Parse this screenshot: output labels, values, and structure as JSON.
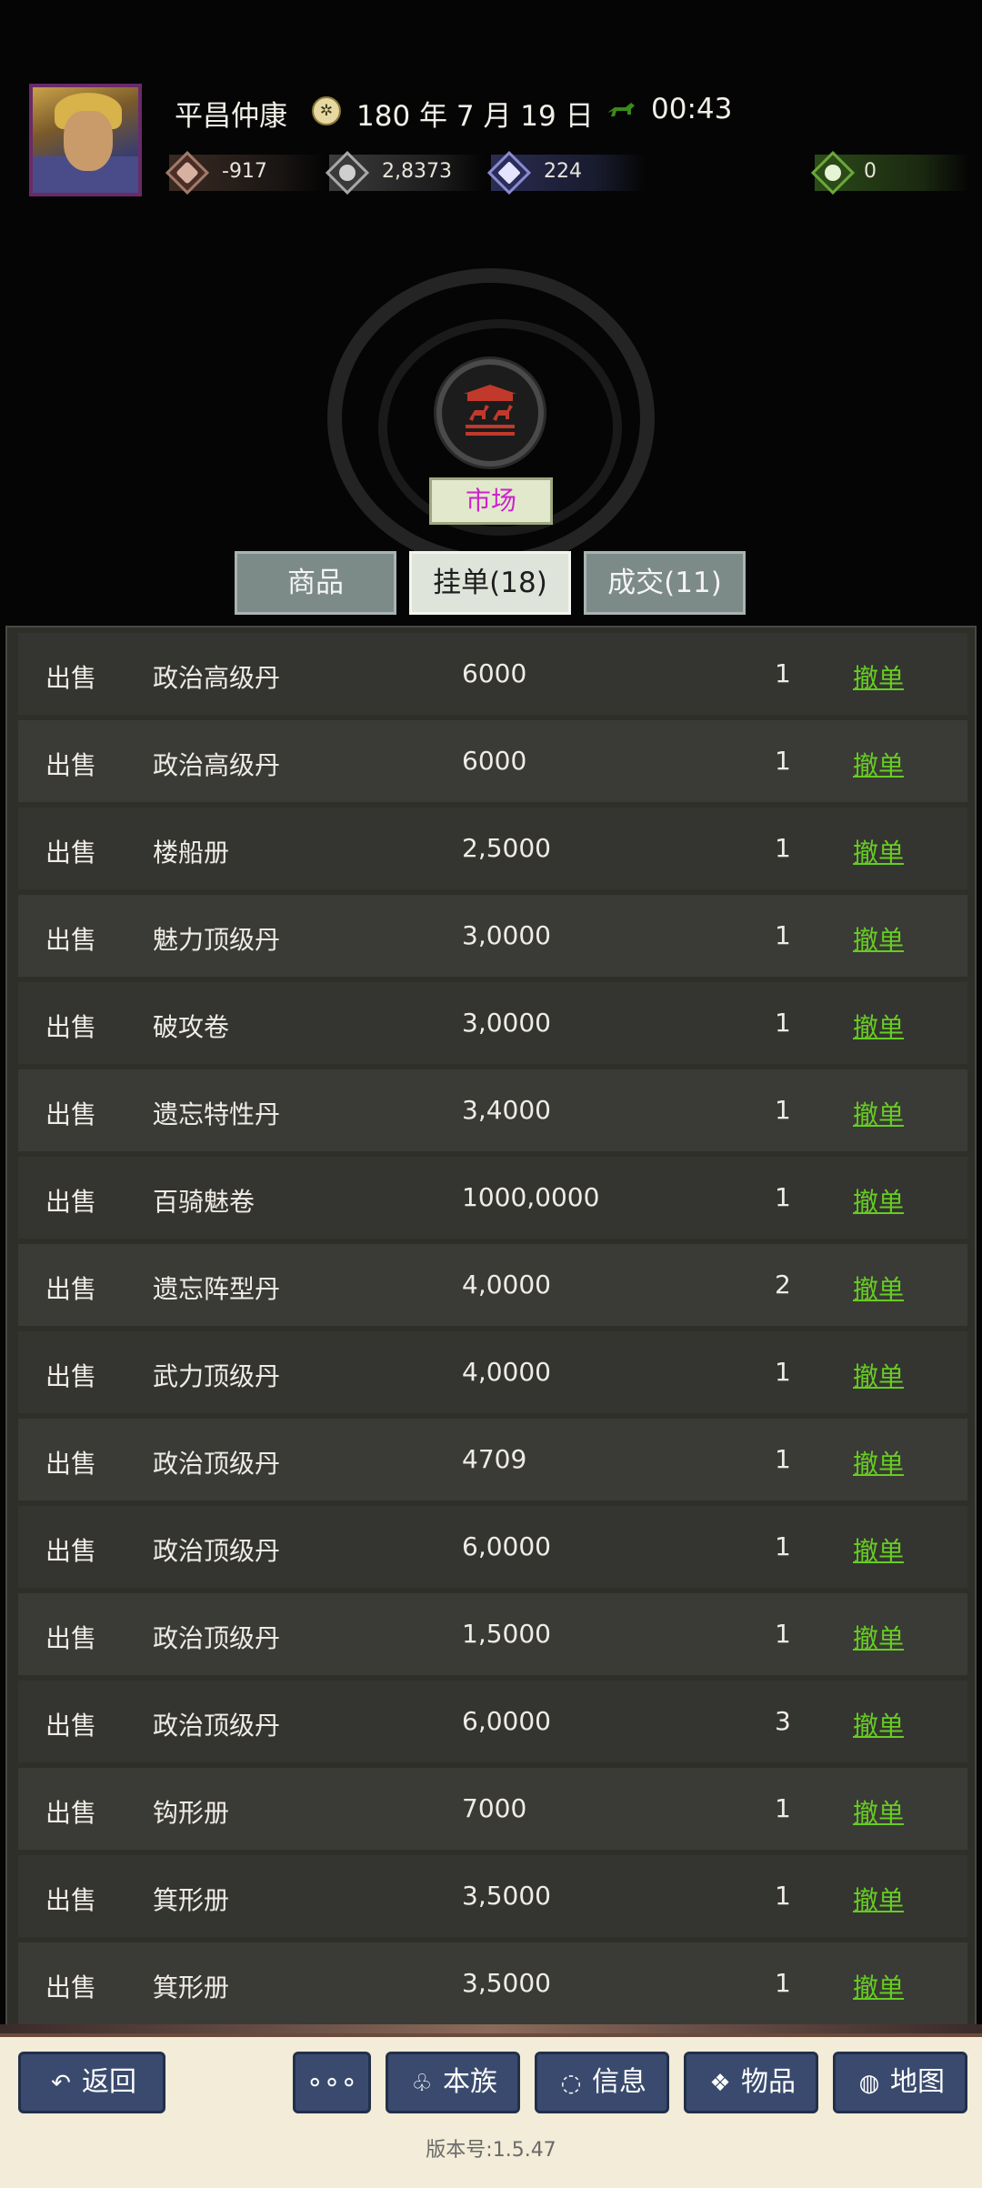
{
  "header": {
    "player_name": "平昌仲康",
    "date": "180 年 7 月 19 日",
    "time": "00:43"
  },
  "stats": [
    {
      "name": "money",
      "value": "-917"
    },
    {
      "name": "food",
      "value": "2,8373"
    },
    {
      "name": "troops",
      "value": "224"
    },
    {
      "name": "item",
      "value": "0"
    }
  ],
  "market": {
    "title": "市场"
  },
  "tabs": [
    {
      "label": "商品"
    },
    {
      "label": "挂单(18)"
    },
    {
      "label": "成交(11)"
    }
  ],
  "orders": [
    {
      "type": "出售",
      "name": "政治高级丹",
      "price": "6000",
      "qty": "1",
      "action": "撤单"
    },
    {
      "type": "出售",
      "name": "政治高级丹",
      "price": "6000",
      "qty": "1",
      "action": "撤单"
    },
    {
      "type": "出售",
      "name": "楼船册",
      "price": "2,5000",
      "qty": "1",
      "action": "撤单"
    },
    {
      "type": "出售",
      "name": "魅力顶级丹",
      "price": "3,0000",
      "qty": "1",
      "action": "撤单"
    },
    {
      "type": "出售",
      "name": "破攻卷",
      "price": "3,0000",
      "qty": "1",
      "action": "撤单"
    },
    {
      "type": "出售",
      "name": "遗忘特性丹",
      "price": "3,4000",
      "qty": "1",
      "action": "撤单"
    },
    {
      "type": "出售",
      "name": "百骑魅卷",
      "price": "1000,0000",
      "qty": "1",
      "action": "撤单"
    },
    {
      "type": "出售",
      "name": "遗忘阵型丹",
      "price": "4,0000",
      "qty": "2",
      "action": "撤单"
    },
    {
      "type": "出售",
      "name": "武力顶级丹",
      "price": "4,0000",
      "qty": "1",
      "action": "撤单"
    },
    {
      "type": "出售",
      "name": "政治顶级丹",
      "price": "4709",
      "qty": "1",
      "action": "撤单"
    },
    {
      "type": "出售",
      "name": "政治顶级丹",
      "price": "6,0000",
      "qty": "1",
      "action": "撤单"
    },
    {
      "type": "出售",
      "name": "政治顶级丹",
      "price": "1,5000",
      "qty": "1",
      "action": "撤单"
    },
    {
      "type": "出售",
      "name": "政治顶级丹",
      "price": "6,0000",
      "qty": "3",
      "action": "撤单"
    },
    {
      "type": "出售",
      "name": "钩形册",
      "price": "7000",
      "qty": "1",
      "action": "撤单"
    },
    {
      "type": "出售",
      "name": "箕形册",
      "price": "3,5000",
      "qty": "1",
      "action": "撤单"
    },
    {
      "type": "出售",
      "name": "箕形册",
      "price": "3,5000",
      "qty": "1",
      "action": "撤单"
    }
  ],
  "footer": {
    "back": "返回",
    "more": "∘∘∘",
    "clan": "本族",
    "info": "信息",
    "items": "物品",
    "map": "地图",
    "version": "版本号:1.5.47"
  },
  "colors": {
    "cancel_link": "#66cc22",
    "market_title": "#cc22cc",
    "footer_button": "#3a4a6e"
  }
}
